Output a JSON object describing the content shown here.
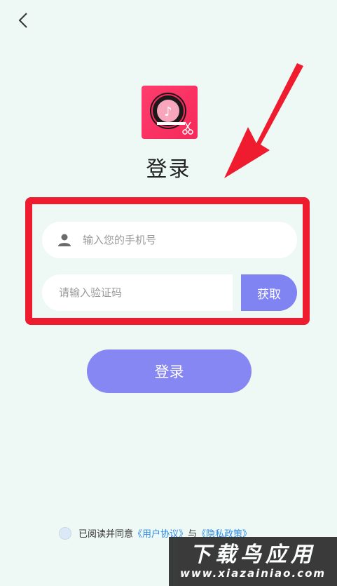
{
  "header": {
    "back_icon": "chevron-left-icon"
  },
  "app": {
    "logo_icon": "music-disc-scissors-icon",
    "title": "登录"
  },
  "form": {
    "phone_placeholder": "输入您的手机号",
    "phone_value": "",
    "code_placeholder": "请输入验证码",
    "code_value": "",
    "get_code_label": "获取",
    "login_label": "登录"
  },
  "agreement": {
    "prefix": "已阅读并同意",
    "user_agreement": "《用户协议》",
    "conjunction": "与",
    "privacy_policy": "《隐私政策》"
  },
  "watermark": {
    "title": "下载鸟应用",
    "url": "www.xiazainiao.com"
  },
  "colors": {
    "background": "#eef9f5",
    "accent": "#8083f2",
    "highlight": "#ee1c2e",
    "logo": "#f5295a",
    "link": "#2d8be8"
  }
}
